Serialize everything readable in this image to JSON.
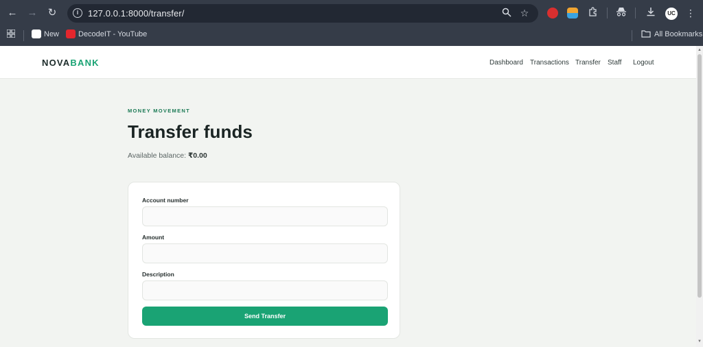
{
  "browser": {
    "url": "127.0.0.1:8000/transfer/",
    "bookmarks": [
      {
        "label": "New",
        "icon": "uc-icon"
      },
      {
        "label": "DecodeIT - YouTube",
        "icon": "youtube-icon"
      }
    ],
    "all_bookmarks_label": "All Bookmarks",
    "avatar_text": "UC"
  },
  "site": {
    "logo_primary": "NOVA",
    "logo_accent": "BANK",
    "nav": [
      "Dashboard",
      "Transactions",
      "Transfer",
      "Staff",
      "Logout"
    ],
    "accent_color": "#1aa374"
  },
  "page": {
    "eyebrow": "MONEY MOVEMENT",
    "title": "Transfer funds",
    "balance_label": "Available balance: ",
    "balance_value": "₹0.00"
  },
  "form": {
    "fields": [
      {
        "label": "Account number",
        "value": "",
        "placeholder": ""
      },
      {
        "label": "Amount",
        "value": "",
        "placeholder": ""
      },
      {
        "label": "Description",
        "value": "",
        "placeholder": ""
      }
    ],
    "submit_label": "Send Transfer"
  }
}
